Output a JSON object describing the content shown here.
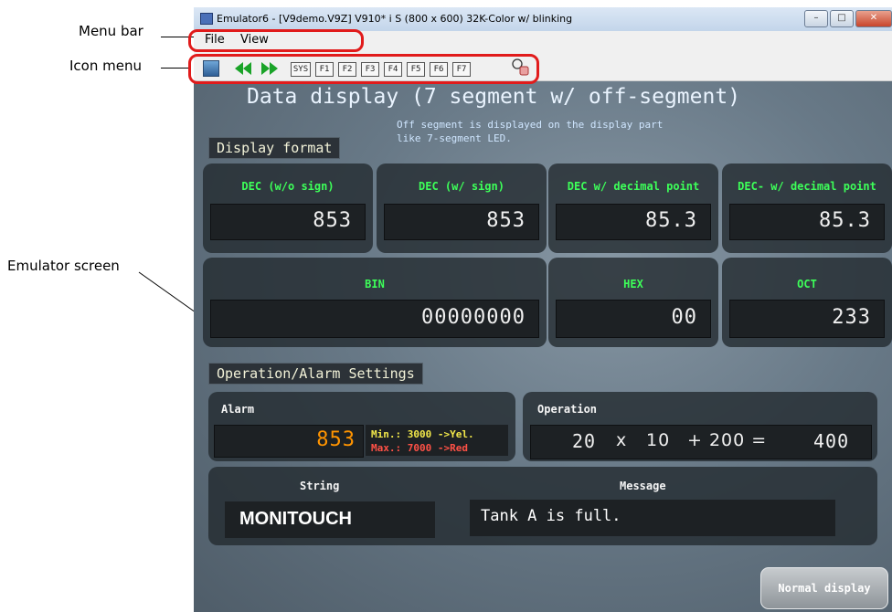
{
  "annotations": {
    "menu_bar": "Menu bar",
    "icon_menu": "Icon menu",
    "emulator_screen": "Emulator screen"
  },
  "window": {
    "title": "Emulator6 - [V9demo.V9Z] V910* i S (800 x 600) 32K-Color w/ blinking",
    "minimize_icon": "minimize-icon",
    "maximize_icon": "maximize-icon",
    "close_icon": "close-icon"
  },
  "menu": {
    "file": "File",
    "view": "View"
  },
  "toolbar": {
    "buttons": [
      "SYS",
      "F1",
      "F2",
      "F3",
      "F4",
      "F5",
      "F6",
      "F7"
    ]
  },
  "screen": {
    "title": "Data display (7 segment w/ off-segment)",
    "note_line1": "Off segment is displayed on the display part",
    "note_line2": "like 7-segment LED.",
    "display_format": "Display format",
    "dec_nosign_label": "DEC (w/o sign)",
    "dec_nosign_value": "853",
    "dec_sign_label": "DEC (w/ sign)",
    "dec_sign_value": "853",
    "dec_point_label": "DEC w/ decimal point",
    "dec_point_value": "85.3",
    "dec_minus_point_label": "DEC- w/ decimal point",
    "dec_minus_point_value": "85.3",
    "bin_label": "BIN",
    "bin_value": "00000000",
    "hex_label": "HEX",
    "hex_value": "00",
    "oct_label": "OCT",
    "oct_value": "233",
    "op_alarm_header": "Operation/Alarm Settings",
    "alarm_label": "Alarm",
    "alarm_value": "853",
    "alarm_min": "Min.: 3000 ->Yel.",
    "alarm_max": "Max.: 7000 ->Red",
    "operation_label": "Operation",
    "op_a": "20",
    "op_x": "x",
    "op_b": "10",
    "op_plus": "+ 200 =",
    "op_result": "400",
    "string_label": "String",
    "string_value": "MONITOUCH",
    "message_label": "Message",
    "message_value": "Tank A is full.",
    "normal_display_button": "Normal display"
  }
}
